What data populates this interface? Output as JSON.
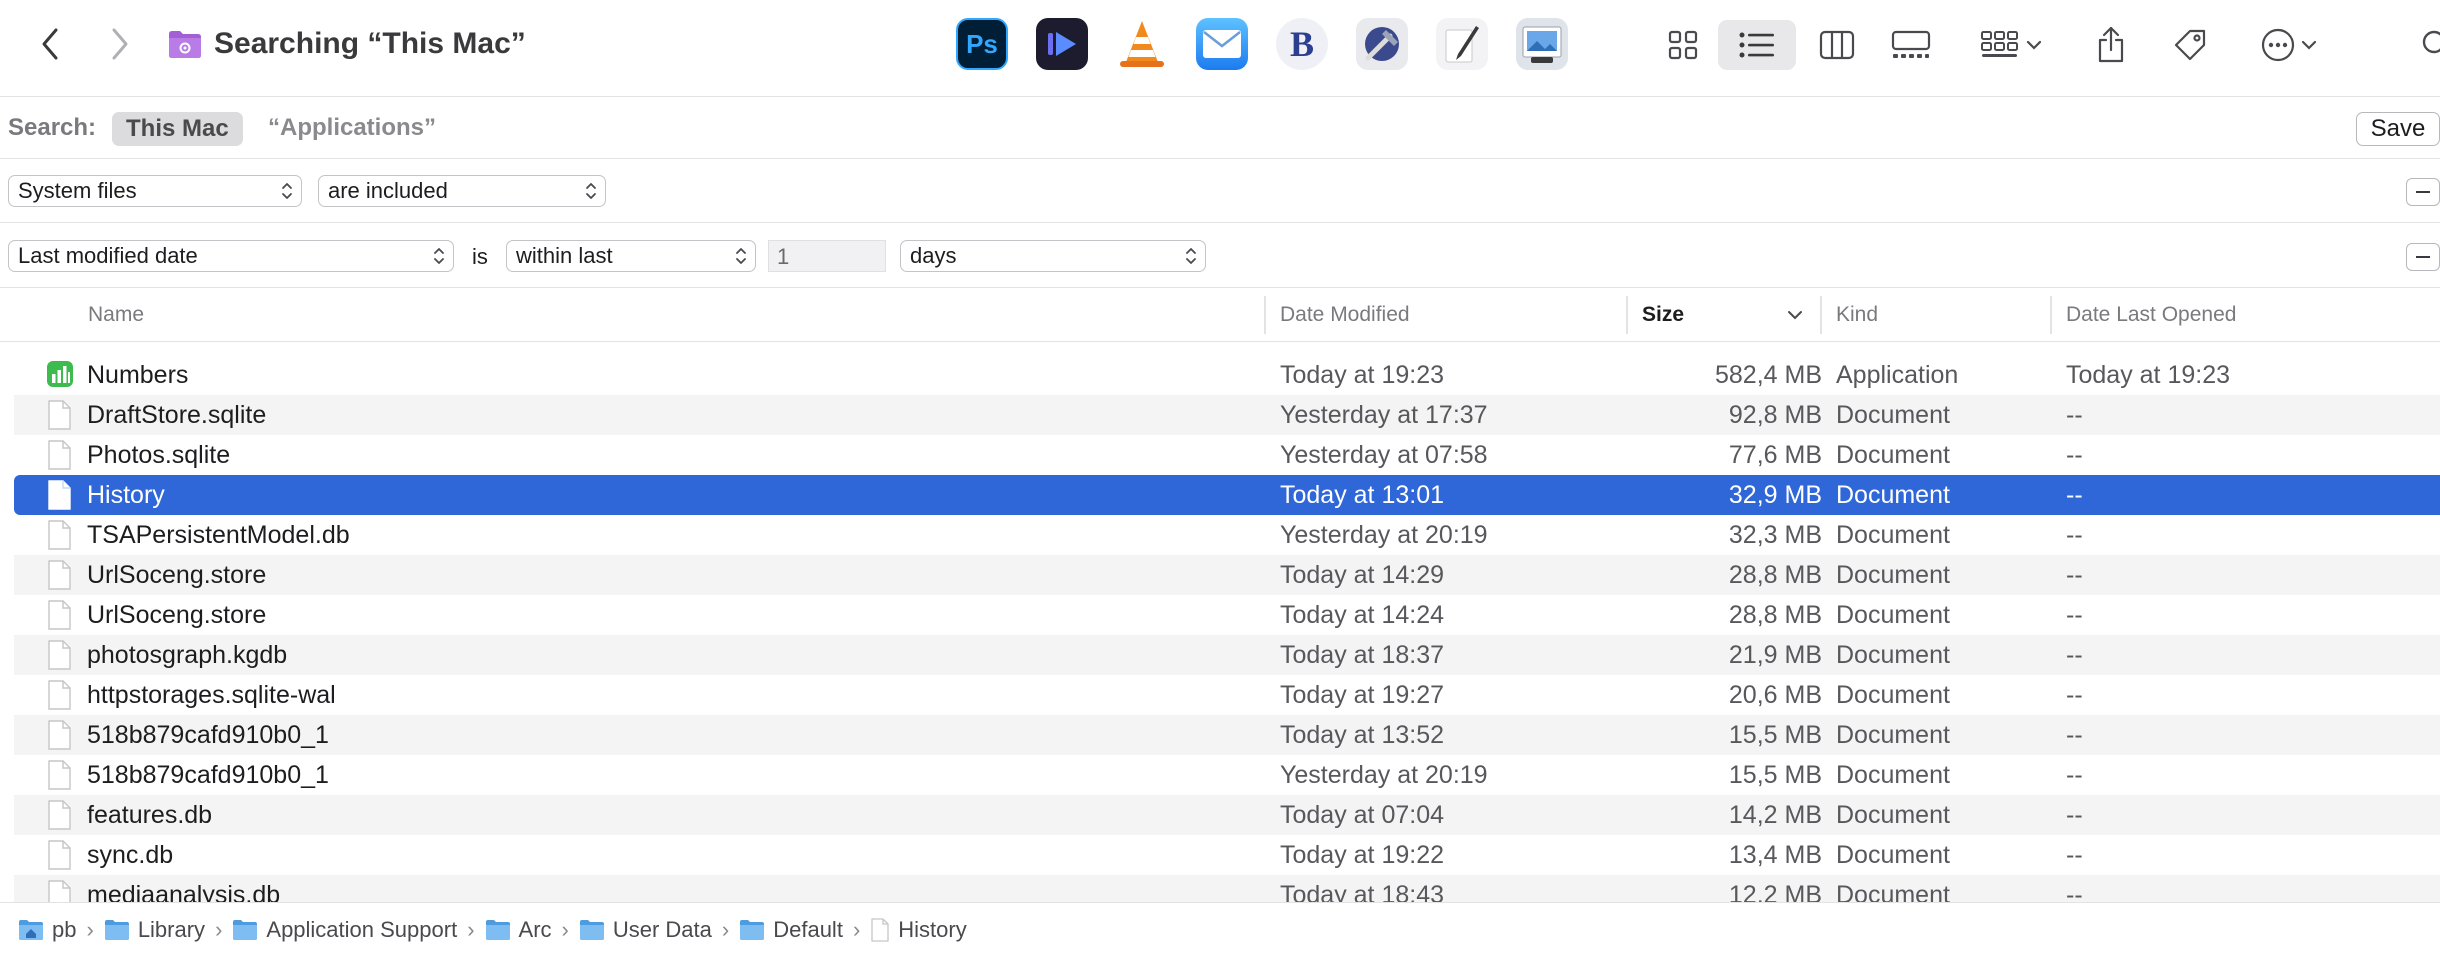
{
  "window": {
    "title": "Searching “This Mac”"
  },
  "toolbar": {
    "apps": [
      {
        "name": "photoshop-app-icon",
        "label": "Ps"
      },
      {
        "name": "infuse-app-icon",
        "label": ""
      },
      {
        "name": "vlc-app-icon",
        "label": ""
      },
      {
        "name": "mail-app-icon",
        "label": ""
      },
      {
        "name": "bbedit-app-icon",
        "label": "B"
      },
      {
        "name": "xcode-instruments-app-icon",
        "label": ""
      },
      {
        "name": "script-editor-app-icon",
        "label": ""
      },
      {
        "name": "preview-app-icon",
        "label": ""
      }
    ]
  },
  "search": {
    "label": "Search:",
    "scope_selected": "This Mac",
    "scope_other": "“Applications”",
    "save_label": "Save"
  },
  "criteria": [
    {
      "attribute": "System files",
      "operator": "are included"
    },
    {
      "attribute": "Last modified date",
      "connector": "is",
      "operator": "within last",
      "value": "1",
      "unit": "days"
    }
  ],
  "columns": {
    "name": "Name",
    "date_modified": "Date Modified",
    "size": "Size",
    "kind": "Kind",
    "date_last_opened": "Date Last Opened"
  },
  "files": [
    {
      "name": "Numbers",
      "date": "Today at 19:23",
      "size": "582,4 MB",
      "kind": "Application",
      "opened": "Today at 19:23",
      "icon": "numbers-app-icon"
    },
    {
      "name": "DraftStore.sqlite",
      "date": "Yesterday at 17:37",
      "size": "92,8 MB",
      "kind": "Document",
      "opened": "--",
      "icon": "document-icon"
    },
    {
      "name": "Photos.sqlite",
      "date": "Yesterday at 07:58",
      "size": "77,6 MB",
      "kind": "Document",
      "opened": "--",
      "icon": "document-icon"
    },
    {
      "name": "History",
      "date": "Today at 13:01",
      "size": "32,9 MB",
      "kind": "Document",
      "opened": "--",
      "icon": "document-icon"
    },
    {
      "name": "TSAPersistentModel.db",
      "date": "Yesterday at 20:19",
      "size": "32,3 MB",
      "kind": "Document",
      "opened": "--",
      "icon": "document-icon"
    },
    {
      "name": "UrlSoceng.store",
      "date": "Today at 14:29",
      "size": "28,8 MB",
      "kind": "Document",
      "opened": "--",
      "icon": "document-icon"
    },
    {
      "name": "UrlSoceng.store",
      "date": "Today at 14:24",
      "size": "28,8 MB",
      "kind": "Document",
      "opened": "--",
      "icon": "document-icon"
    },
    {
      "name": "photosgraph.kgdb",
      "date": "Today at 18:37",
      "size": "21,9 MB",
      "kind": "Document",
      "opened": "--",
      "icon": "document-icon"
    },
    {
      "name": "httpstorages.sqlite-wal",
      "date": "Today at 19:27",
      "size": "20,6 MB",
      "kind": "Document",
      "opened": "--",
      "icon": "document-icon"
    },
    {
      "name": "518b879cafd910b0_1",
      "date": "Today at 13:52",
      "size": "15,5 MB",
      "kind": "Document",
      "opened": "--",
      "icon": "document-icon"
    },
    {
      "name": "518b879cafd910b0_1",
      "date": "Yesterday at 20:19",
      "size": "15,5 MB",
      "kind": "Document",
      "opened": "--",
      "icon": "document-icon"
    },
    {
      "name": "features.db",
      "date": "Today at 07:04",
      "size": "14,2 MB",
      "kind": "Document",
      "opened": "--",
      "icon": "document-icon"
    },
    {
      "name": "sync.db",
      "date": "Today at 19:22",
      "size": "13,4 MB",
      "kind": "Document",
      "opened": "--",
      "icon": "document-icon"
    },
    {
      "name": "mediaanalysis.db",
      "date": "Today at 18:43",
      "size": "12,2 MB",
      "kind": "Document",
      "opened": "--",
      "icon": "document-icon"
    }
  ],
  "selected_file": "History",
  "path": [
    {
      "label": "pb",
      "icon": "home-folder-icon"
    },
    {
      "label": "Library",
      "icon": "folder-icon"
    },
    {
      "label": "Application Support",
      "icon": "folder-icon"
    },
    {
      "label": "Arc",
      "icon": "folder-icon"
    },
    {
      "label": "User Data",
      "icon": "folder-icon"
    },
    {
      "label": "Default",
      "icon": "folder-icon"
    },
    {
      "label": "History",
      "icon": "document-icon"
    }
  ],
  "colors": {
    "selection": "#2f67d8",
    "alt_row": "#f4f4f5",
    "folder_blue": "#5aa6e8",
    "smart_folder_purple": "#a25fd6"
  }
}
